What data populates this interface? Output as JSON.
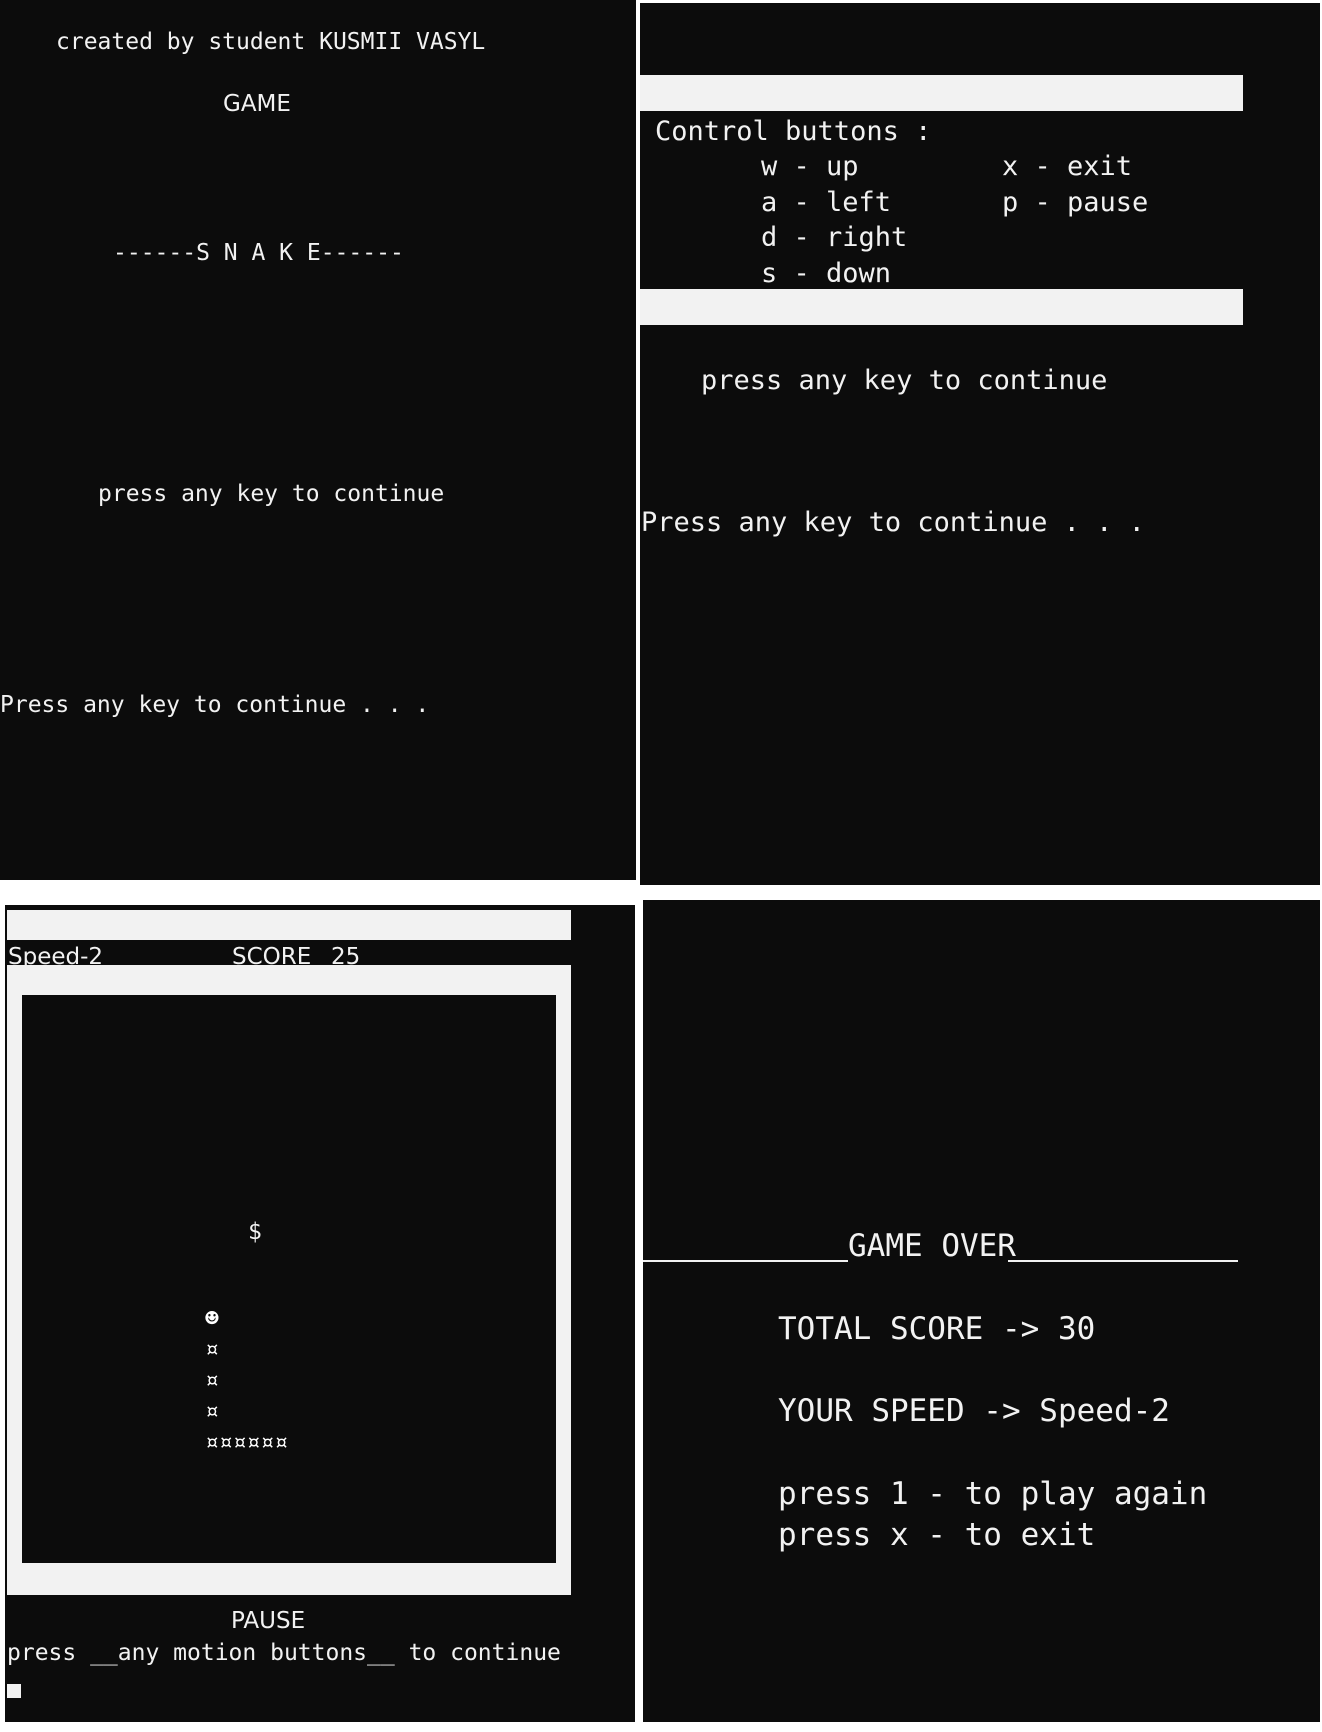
{
  "intro": {
    "credit": "created by student KUSMII VASYL",
    "game_label": "GAME",
    "title": "------S N A K E------",
    "prompt": "press any key to continue",
    "system_prompt": "Press any key to continue . . ."
  },
  "controls": {
    "heading": "Control buttons :",
    "keys": [
      "w - up",
      "a - left",
      "d - right",
      "s - down"
    ],
    "extra_keys": [
      "x - exit",
      "p - pause"
    ],
    "prompt": "press any key to continue",
    "system_prompt": "Press any key to continue . . ."
  },
  "game": {
    "speed": "Speed-2",
    "score_label": "SCORE",
    "score_value": "25",
    "food_symbol": "$",
    "head_symbol": "☻",
    "body_symbol": "¤",
    "body_horizontal": "¤¤¤¤¤¤",
    "pause_label": "PAUSE",
    "pause_prompt": "press __any motion buttons__ to continue"
  },
  "gameover": {
    "title": "GAME OVER",
    "total_score": "TOTAL SCORE -> 30",
    "your_speed": "YOUR SPEED -> Speed-2",
    "option_replay": "press 1 - to play again",
    "option_exit": "press x - to exit"
  },
  "colors": {
    "terminal_bg": "#0c0c0c",
    "terminal_fg": "#f2f2f2",
    "page_bg": "#ffffff"
  }
}
